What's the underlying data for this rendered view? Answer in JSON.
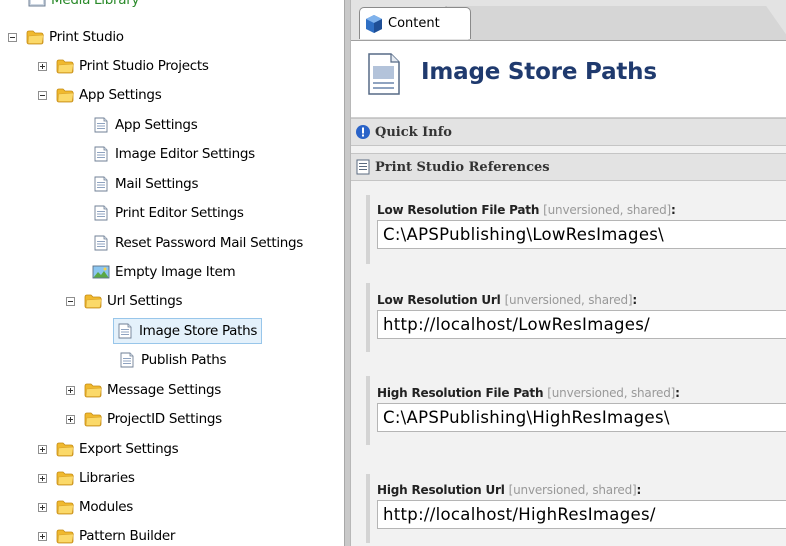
{
  "tree": {
    "items": [
      {
        "label": "Media Library",
        "icon": "media-library-icon"
      },
      {
        "label": "Print Studio",
        "icon": "folder-icon"
      },
      {
        "label": "Print Studio Projects",
        "icon": "folder-icon"
      },
      {
        "label": "App Settings",
        "icon": "folder-icon"
      },
      {
        "label": "App Settings",
        "icon": "document-icon"
      },
      {
        "label": "Image Editor Settings",
        "icon": "document-icon"
      },
      {
        "label": "Mail Settings",
        "icon": "document-icon"
      },
      {
        "label": "Print Editor Settings",
        "icon": "document-icon"
      },
      {
        "label": "Reset Password Mail Settings",
        "icon": "document-icon"
      },
      {
        "label": "Empty Image Item",
        "icon": "image-icon"
      },
      {
        "label": "Url Settings",
        "icon": "folder-icon"
      },
      {
        "label": "Image Store Paths",
        "icon": "document-icon",
        "selected": true
      },
      {
        "label": "Publish Paths",
        "icon": "document-icon"
      },
      {
        "label": "Message Settings",
        "icon": "folder-icon"
      },
      {
        "label": "ProjectID Settings",
        "icon": "folder-icon"
      },
      {
        "label": "Export Settings",
        "icon": "folder-icon"
      },
      {
        "label": "Libraries",
        "icon": "folder-icon"
      },
      {
        "label": "Modules",
        "icon": "folder-icon"
      },
      {
        "label": "Pattern Builder",
        "icon": "folder-icon"
      }
    ]
  },
  "content": {
    "tab_label": "Content",
    "page_title": "Image Store Paths",
    "sections": {
      "quick_info": "Quick Info",
      "references": "Print Studio References"
    },
    "fields": [
      {
        "label": "Low Resolution File Path",
        "meta": "[unversioned, shared]",
        "colon": ":",
        "value": "C:\\APSPublishing\\LowResImages\\"
      },
      {
        "label": "Low Resolution Url",
        "meta": "[unversioned, shared]",
        "colon": ":",
        "value": "http://localhost/LowResImages/"
      },
      {
        "label": "High Resolution File Path",
        "meta": "[unversioned, shared]",
        "colon": ":",
        "value": "C:\\APSPublishing\\HighResImages\\"
      },
      {
        "label": "High Resolution Url",
        "meta": "[unversioned, shared]",
        "colon": ":",
        "value": "http://localhost/HighResImages/"
      }
    ]
  },
  "colors": {
    "title": "#1f3a6e",
    "selection": "#e4f1fb",
    "folder": "#f3c64a"
  }
}
